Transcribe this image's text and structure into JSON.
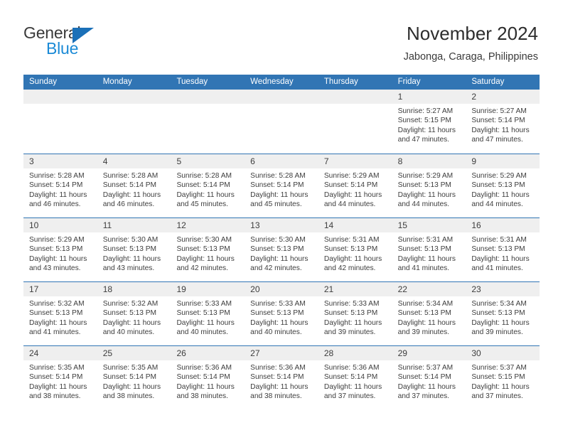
{
  "brand": {
    "name_top": "General",
    "name_bottom": "Blue",
    "triangle_color": "#1b70b8",
    "blue_text_color": "#1b8ad6"
  },
  "header": {
    "title": "November 2024",
    "subtitle": "Jabonga, Caraga, Philippines"
  },
  "colors": {
    "header_blue": "#3175b4",
    "day_strip_gray": "#efefef",
    "text": "#3d3d3d"
  },
  "weekdays": [
    "Sunday",
    "Monday",
    "Tuesday",
    "Wednesday",
    "Thursday",
    "Friday",
    "Saturday"
  ],
  "weeks": [
    [
      {
        "empty": true
      },
      {
        "empty": true
      },
      {
        "empty": true
      },
      {
        "empty": true
      },
      {
        "empty": true
      },
      {
        "day": "1",
        "sunrise": "Sunrise: 5:27 AM",
        "sunset": "Sunset: 5:15 PM",
        "daylight": "Daylight: 11 hours and 47 minutes."
      },
      {
        "day": "2",
        "sunrise": "Sunrise: 5:27 AM",
        "sunset": "Sunset: 5:14 PM",
        "daylight": "Daylight: 11 hours and 47 minutes."
      }
    ],
    [
      {
        "day": "3",
        "sunrise": "Sunrise: 5:28 AM",
        "sunset": "Sunset: 5:14 PM",
        "daylight": "Daylight: 11 hours and 46 minutes."
      },
      {
        "day": "4",
        "sunrise": "Sunrise: 5:28 AM",
        "sunset": "Sunset: 5:14 PM",
        "daylight": "Daylight: 11 hours and 46 minutes."
      },
      {
        "day": "5",
        "sunrise": "Sunrise: 5:28 AM",
        "sunset": "Sunset: 5:14 PM",
        "daylight": "Daylight: 11 hours and 45 minutes."
      },
      {
        "day": "6",
        "sunrise": "Sunrise: 5:28 AM",
        "sunset": "Sunset: 5:14 PM",
        "daylight": "Daylight: 11 hours and 45 minutes."
      },
      {
        "day": "7",
        "sunrise": "Sunrise: 5:29 AM",
        "sunset": "Sunset: 5:14 PM",
        "daylight": "Daylight: 11 hours and 44 minutes."
      },
      {
        "day": "8",
        "sunrise": "Sunrise: 5:29 AM",
        "sunset": "Sunset: 5:13 PM",
        "daylight": "Daylight: 11 hours and 44 minutes."
      },
      {
        "day": "9",
        "sunrise": "Sunrise: 5:29 AM",
        "sunset": "Sunset: 5:13 PM",
        "daylight": "Daylight: 11 hours and 44 minutes."
      }
    ],
    [
      {
        "day": "10",
        "sunrise": "Sunrise: 5:29 AM",
        "sunset": "Sunset: 5:13 PM",
        "daylight": "Daylight: 11 hours and 43 minutes."
      },
      {
        "day": "11",
        "sunrise": "Sunrise: 5:30 AM",
        "sunset": "Sunset: 5:13 PM",
        "daylight": "Daylight: 11 hours and 43 minutes."
      },
      {
        "day": "12",
        "sunrise": "Sunrise: 5:30 AM",
        "sunset": "Sunset: 5:13 PM",
        "daylight": "Daylight: 11 hours and 42 minutes."
      },
      {
        "day": "13",
        "sunrise": "Sunrise: 5:30 AM",
        "sunset": "Sunset: 5:13 PM",
        "daylight": "Daylight: 11 hours and 42 minutes."
      },
      {
        "day": "14",
        "sunrise": "Sunrise: 5:31 AM",
        "sunset": "Sunset: 5:13 PM",
        "daylight": "Daylight: 11 hours and 42 minutes."
      },
      {
        "day": "15",
        "sunrise": "Sunrise: 5:31 AM",
        "sunset": "Sunset: 5:13 PM",
        "daylight": "Daylight: 11 hours and 41 minutes."
      },
      {
        "day": "16",
        "sunrise": "Sunrise: 5:31 AM",
        "sunset": "Sunset: 5:13 PM",
        "daylight": "Daylight: 11 hours and 41 minutes."
      }
    ],
    [
      {
        "day": "17",
        "sunrise": "Sunrise: 5:32 AM",
        "sunset": "Sunset: 5:13 PM",
        "daylight": "Daylight: 11 hours and 41 minutes."
      },
      {
        "day": "18",
        "sunrise": "Sunrise: 5:32 AM",
        "sunset": "Sunset: 5:13 PM",
        "daylight": "Daylight: 11 hours and 40 minutes."
      },
      {
        "day": "19",
        "sunrise": "Sunrise: 5:33 AM",
        "sunset": "Sunset: 5:13 PM",
        "daylight": "Daylight: 11 hours and 40 minutes."
      },
      {
        "day": "20",
        "sunrise": "Sunrise: 5:33 AM",
        "sunset": "Sunset: 5:13 PM",
        "daylight": "Daylight: 11 hours and 40 minutes."
      },
      {
        "day": "21",
        "sunrise": "Sunrise: 5:33 AM",
        "sunset": "Sunset: 5:13 PM",
        "daylight": "Daylight: 11 hours and 39 minutes."
      },
      {
        "day": "22",
        "sunrise": "Sunrise: 5:34 AM",
        "sunset": "Sunset: 5:13 PM",
        "daylight": "Daylight: 11 hours and 39 minutes."
      },
      {
        "day": "23",
        "sunrise": "Sunrise: 5:34 AM",
        "sunset": "Sunset: 5:13 PM",
        "daylight": "Daylight: 11 hours and 39 minutes."
      }
    ],
    [
      {
        "day": "24",
        "sunrise": "Sunrise: 5:35 AM",
        "sunset": "Sunset: 5:14 PM",
        "daylight": "Daylight: 11 hours and 38 minutes."
      },
      {
        "day": "25",
        "sunrise": "Sunrise: 5:35 AM",
        "sunset": "Sunset: 5:14 PM",
        "daylight": "Daylight: 11 hours and 38 minutes."
      },
      {
        "day": "26",
        "sunrise": "Sunrise: 5:36 AM",
        "sunset": "Sunset: 5:14 PM",
        "daylight": "Daylight: 11 hours and 38 minutes."
      },
      {
        "day": "27",
        "sunrise": "Sunrise: 5:36 AM",
        "sunset": "Sunset: 5:14 PM",
        "daylight": "Daylight: 11 hours and 38 minutes."
      },
      {
        "day": "28",
        "sunrise": "Sunrise: 5:36 AM",
        "sunset": "Sunset: 5:14 PM",
        "daylight": "Daylight: 11 hours and 37 minutes."
      },
      {
        "day": "29",
        "sunrise": "Sunrise: 5:37 AM",
        "sunset": "Sunset: 5:14 PM",
        "daylight": "Daylight: 11 hours and 37 minutes."
      },
      {
        "day": "30",
        "sunrise": "Sunrise: 5:37 AM",
        "sunset": "Sunset: 5:15 PM",
        "daylight": "Daylight: 11 hours and 37 minutes."
      }
    ]
  ]
}
